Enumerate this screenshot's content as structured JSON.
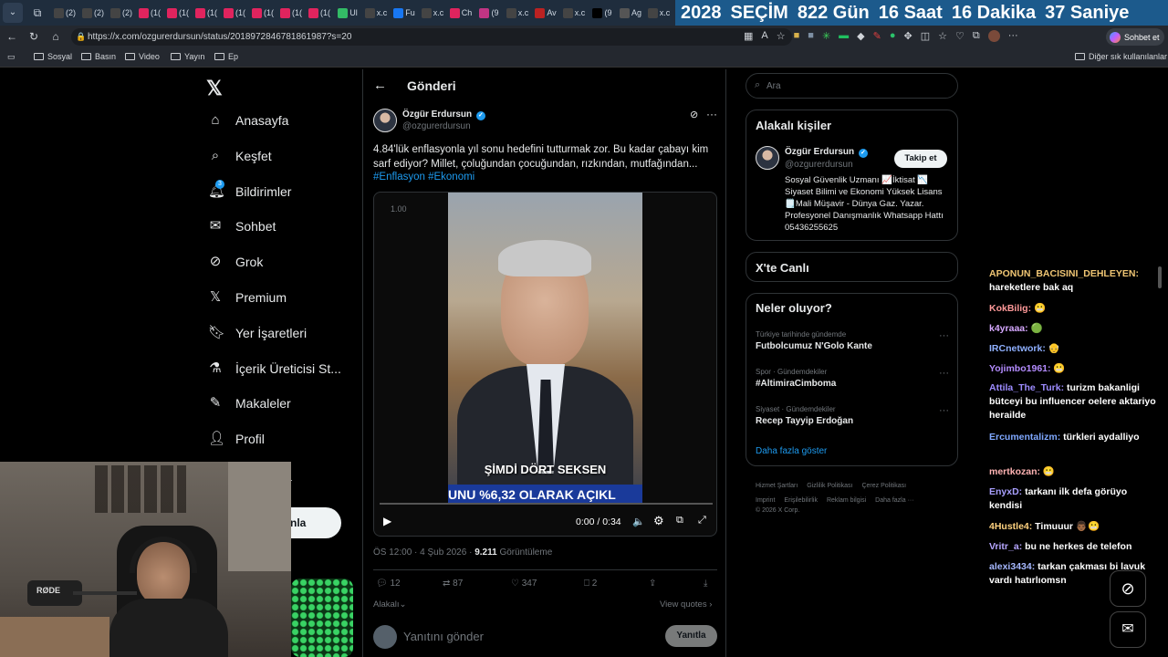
{
  "browser": {
    "tabs": [
      "(2)",
      "(2)",
      "(2)",
      "(1(",
      "(1(",
      "(1(",
      "(1(",
      "(1(",
      "(1(",
      "(1(",
      "Ul",
      "x.c",
      "Fu",
      "x.c",
      "Ch",
      "(9",
      "x.c",
      "Av",
      "x.c",
      "(9",
      "Ag",
      "x.c"
    ],
    "countdown": {
      "year": "2028",
      "label": "SEÇİM",
      "days": "822 Gün",
      "hours": "16 Saat",
      "minutes": "16 Dakika",
      "seconds": "37 Saniye"
    },
    "url": "https://x.com/ozgurerdursun/status/2018972846781861987?s=20",
    "bookmarks": [
      "Sosyal",
      "Basın",
      "Video",
      "Yayın",
      "Ep"
    ],
    "other_bookmarks": "Diğer sık kullanılanlar",
    "chat_button": "Sohbet et"
  },
  "nav": {
    "items": [
      "Anasayfa",
      "Keşfet",
      "Bildirimler",
      "Sohbet",
      "Grok",
      "Premium",
      "Yer İşaretleri",
      "İçerik Üreticisi St...",
      "Makaleler",
      "Profil"
    ],
    "notification_badge": "3",
    "more_label": "a",
    "post_button": "nla"
  },
  "post": {
    "header_title": "Gönderi",
    "author_name": "Özgür Erdursun",
    "author_handle": "@ozgurerdursun",
    "text": "4.84'lük enflasyonla yıl sonu hedefini tutturmak zor. Bu kadar çabayı kim sarf ediyor? Millet, çoluğundan çocuğundan, rızkından, mutfağından...",
    "hashtags": "#Enflasyon #Ekonomi",
    "video": {
      "speed": "1.00",
      "caption1": "ŞİMDİ DÖRT SEKSEN",
      "caption2": "UNU %6,32 OLARAK AÇIKL",
      "time": "0:00 / 0:34"
    },
    "meta_time": "ÖS 12:00 · 4 Şub 2026 · ",
    "views_count": "9.211",
    "views_label": " Görüntüleme",
    "stats": {
      "replies": "12",
      "reposts": "87",
      "likes": "347",
      "bookmarks": "2"
    },
    "related": "Alakalı",
    "view_quotes": "View quotes",
    "reply_placeholder": "Yanıtını gönder",
    "reply_button": "Yanıtla"
  },
  "sidebar": {
    "search_placeholder": "Ara",
    "related_title": "Alakalı kişiler",
    "person_name": "Özgür Erdursun",
    "person_handle": "@ozgurerdursun",
    "follow_button": "Takip et",
    "bio": "Sosyal Güvenlik Uzmanı 📈İktisat 📉 Siyaset Bilimi ve Ekonomi Yüksek Lisans 🗒️Mali Müşavir - Dünya Gaz. Yazar. Profesyonel Danışmanlık Whatsapp Hattı 05436255625",
    "live_title": "X'te Canlı",
    "trends_title": "Neler oluyor?",
    "trends": [
      {
        "context": "Türkiye tarihinde gündemde",
        "topic": "Futbolcumuz N'Golo Kante"
      },
      {
        "context": "Spor · Gündemdekiler",
        "topic": "#AltimiraCimboma"
      },
      {
        "context": "Siyaset · Gündemdekiler",
        "topic": "Recep Tayyip Erdoğan"
      }
    ],
    "show_more": "Daha fazla göster",
    "footer_links": [
      "Hizmet Şartları",
      "Gizlilik Politikası",
      "Çerez Politikası",
      "Imprint",
      "Erişilebilirlik",
      "Reklam bilgisi",
      "Daha fazla ···"
    ],
    "copyright": "© 2026 X Corp."
  },
  "chat": [
    {
      "user": "APONUN_BACISINI_DEHLEYEN:",
      "msg": " hareketlere bak aq",
      "color": "#f0c674"
    },
    {
      "user": "KokBilig:",
      "msg": " 😬",
      "color": "#ff9999"
    },
    {
      "user": "k4yraaa:",
      "msg": " 🟢",
      "color": "#d6a8ff"
    },
    {
      "user": "IRCnetwork:",
      "msg": " 👴",
      "color": "#8fb0ff"
    },
    {
      "user": "Yojimbo1961:",
      "msg": " 😬",
      "color": "#b48cff"
    },
    {
      "user": "Attila_The_Turk:",
      "msg": " turizm bakanligi bütceyi bu influencer oelere aktariyo herailde",
      "color": "#9d8cff"
    },
    {
      "user": "Ercumentalizm:",
      "msg": " türkleri aydalliyo",
      "color": "#7fa8ff"
    },
    {
      "user": "mertkozan:",
      "msg": " 😬",
      "color": "#ffb3b3"
    },
    {
      "user": "EnyxD:",
      "msg": " tarkanı ilk defa görüyo kendisi",
      "color": "#a9a0ff"
    },
    {
      "user": "4Hustle4:",
      "msg": " Timuuur 👨🏾😬",
      "color": "#ffd27f"
    },
    {
      "user": "Vritr_a:",
      "msg": " bu ne herkes de telefon",
      "color": "#b6a6ff"
    },
    {
      "user": "alexi3434:",
      "msg": " tarkan çakması bi lavuk vardı hatırlıomsn",
      "color": "#a6b8ff"
    }
  ],
  "colors": {
    "accent": "#1d9bf0",
    "countdown_bg": "#1c5a8c",
    "background": "#000000"
  }
}
